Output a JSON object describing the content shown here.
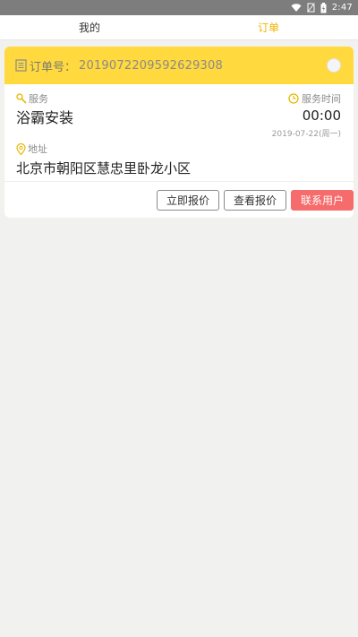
{
  "status_bar": {
    "time": "2:47",
    "icons": [
      "wifi-icon",
      "no-sim-icon",
      "battery-icon"
    ]
  },
  "tabs": [
    {
      "label": "我的",
      "active": false
    },
    {
      "label": "订单",
      "active": true
    }
  ],
  "order": {
    "order_no_label": "订单号：",
    "order_no": "2019072209592629308",
    "service_label": "服务",
    "service_name": "浴霸安装",
    "time_label": "服务时间",
    "time_value": "00:00",
    "date_value": "2019-07-22(周一)",
    "address_label": "地址",
    "address_value": "北京市朝阳区慧忠里卧龙小区"
  },
  "actions": {
    "quote": "立即报价",
    "view_quote": "查看报价",
    "contact": "联系用户"
  },
  "colors": {
    "accent": "#ffd93d",
    "active_tab": "#f0b400",
    "contact_button": "#f66b6b",
    "status_bar": "#7d7d7d"
  }
}
